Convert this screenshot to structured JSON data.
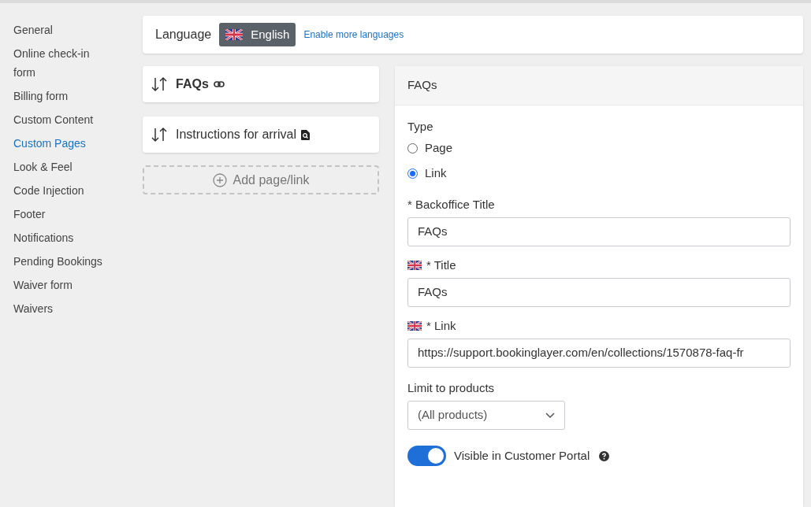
{
  "sidebar": {
    "items": [
      {
        "label": "General",
        "selected": false
      },
      {
        "label": "Online check-in form",
        "selected": false
      },
      {
        "label": "Billing form",
        "selected": false
      },
      {
        "label": "Custom Content",
        "selected": false
      },
      {
        "label": "Custom Pages",
        "selected": true
      },
      {
        "label": "Look & Feel",
        "selected": false
      },
      {
        "label": "Code Injection",
        "selected": false
      },
      {
        "label": "Footer",
        "selected": false
      },
      {
        "label": "Notifications",
        "selected": false
      },
      {
        "label": "Pending Bookings",
        "selected": false
      },
      {
        "label": "Waiver form",
        "selected": false
      },
      {
        "label": "Waivers",
        "selected": false
      }
    ]
  },
  "language_bar": {
    "label": "Language",
    "language": "English",
    "enable_link": "Enable more languages"
  },
  "pages": [
    {
      "title": "FAQs",
      "kind": "link",
      "selected": true
    },
    {
      "title": "Instructions for arrival",
      "kind": "page",
      "selected": false
    }
  ],
  "add_button": "Add page/link",
  "editor": {
    "header": "FAQs",
    "type_label": "Type",
    "type_options": [
      {
        "label": "Page",
        "selected": false
      },
      {
        "label": "Link",
        "selected": true
      }
    ],
    "fields": [
      {
        "label": "* Backoffice Title",
        "flag": false,
        "value": "FAQs"
      },
      {
        "label": "* Title",
        "flag": true,
        "value": "FAQs"
      },
      {
        "label": "* Link",
        "flag": true,
        "value": "https://support.bookinglayer.com/en/collections/1570878-faq-fr"
      }
    ],
    "limit_label": "Limit to products",
    "limit_value": "(All products)",
    "visible": {
      "label": "Visible in Customer Portal",
      "on": true
    }
  }
}
